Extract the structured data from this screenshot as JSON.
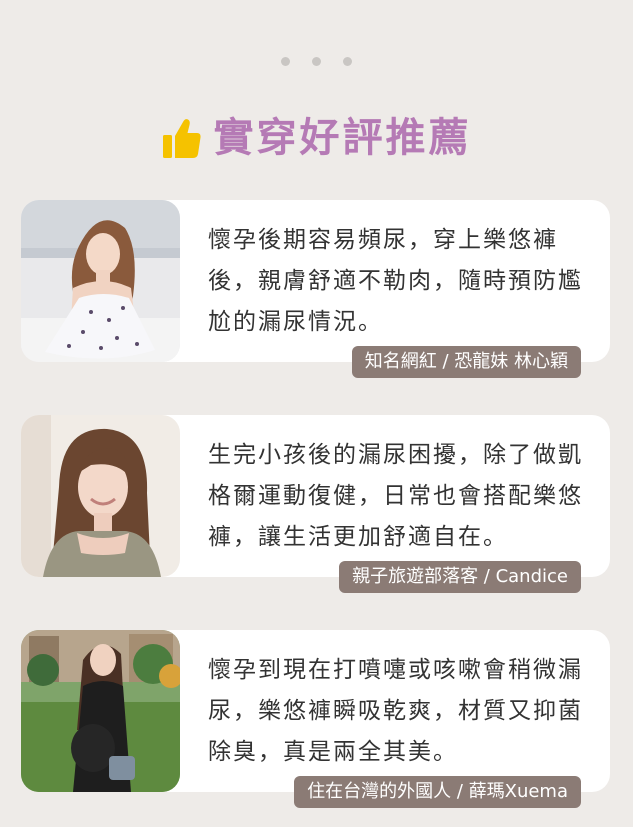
{
  "heading": {
    "title": "實穿好評推薦",
    "icon": "thumbs-up-icon",
    "title_color": "#b57ab5",
    "icon_color": "#f5c200"
  },
  "pagination": {
    "dots": 3
  },
  "testimonials": [
    {
      "quote": "懷孕後期容易頻尿，穿上樂悠褲後，親膚舒適不勒肉，隨時預防尷尬的漏尿情況。",
      "author": "知名網紅 / 恐龍妹  林心穎"
    },
    {
      "quote": "生完小孩後的漏尿困擾，除了做凱格爾運動復健，日常也會搭配樂悠褲，讓生活更加舒適自在。",
      "author": "親子旅遊部落客 / Candice"
    },
    {
      "quote": "懷孕到現在打噴嚏或咳嗽會稍微漏尿，樂悠褲瞬吸乾爽，材質又抑菌除臭，真是兩全其美。",
      "author": "住在台灣的外國人 / 薛瑪Xuema"
    }
  ],
  "colors": {
    "background": "#eeebe8",
    "card": "#ffffff",
    "author_badge": "#8b7b75",
    "quote_text": "#333333"
  }
}
